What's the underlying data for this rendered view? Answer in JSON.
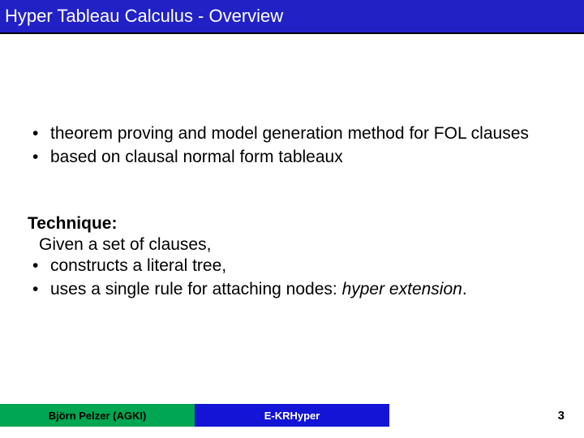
{
  "header": {
    "title": "Hyper Tableau Calculus - Overview"
  },
  "block1": {
    "items": [
      "theorem proving and model generation method for FOL clauses",
      "based on clausal normal form tableaux"
    ]
  },
  "block2": {
    "label": "Technique:",
    "given": "Given a set of clauses,",
    "items": [
      "constructs a literal tree,",
      "uses a single rule for attaching nodes: "
    ],
    "hyper_ext": "hyper extension",
    "period": "."
  },
  "footer": {
    "left": "Björn Pelzer (AGKI)",
    "center": "E-KRHyper",
    "page": "3"
  }
}
